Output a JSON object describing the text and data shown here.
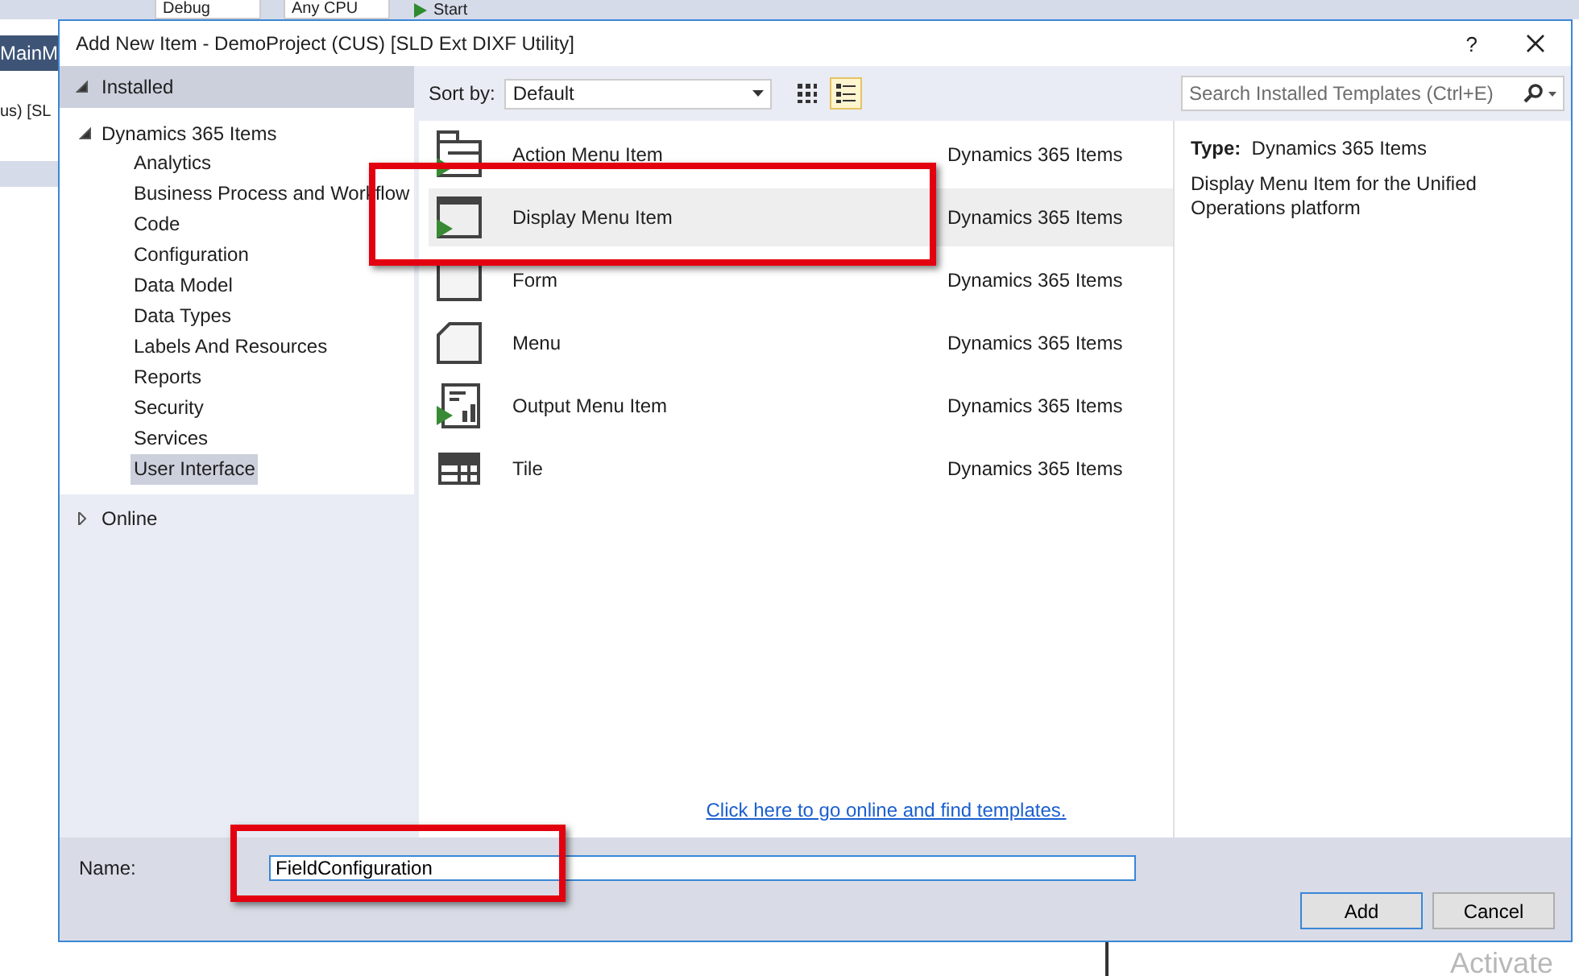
{
  "background": {
    "toolbar": [
      {
        "kind": "dropdown",
        "label": "Debug"
      },
      {
        "kind": "dropdown",
        "label": "Any CPU"
      },
      {
        "kind": "start",
        "label": "Start"
      }
    ],
    "tab": "MainM",
    "path_fragment": "us) [SL",
    "watermark": "Activate"
  },
  "dialog": {
    "title": "Add New Item - DemoProject (CUS) [SLD Ext DIXF Utility]",
    "help": "?"
  },
  "tree": [
    {
      "label": "Installed",
      "expanded": true,
      "children": [
        {
          "label": "Dynamics 365 Items",
          "expanded": true,
          "children": [
            {
              "label": "Analytics",
              "selected": false
            },
            {
              "label": "Business Process and Workflow",
              "selected": false
            },
            {
              "label": "Code",
              "selected": false
            },
            {
              "label": "Configuration",
              "selected": false
            },
            {
              "label": "Data Model",
              "selected": false
            },
            {
              "label": "Data Types",
              "selected": false
            },
            {
              "label": "Labels And Resources",
              "selected": false
            },
            {
              "label": "Reports",
              "selected": false
            },
            {
              "label": "Security",
              "selected": false
            },
            {
              "label": "Services",
              "selected": false
            },
            {
              "label": "User Interface",
              "selected": true
            }
          ]
        }
      ]
    },
    {
      "label": "Online",
      "expanded": false
    }
  ],
  "sort": {
    "label": "Sort by:",
    "value": "Default"
  },
  "view_buttons": [
    {
      "kind": "grid",
      "selected": false
    },
    {
      "kind": "list",
      "selected": true
    }
  ],
  "search": {
    "placeholder": "Search Installed Templates (Ctrl+E)"
  },
  "templates": [
    {
      "kind": "action",
      "name": "Action Menu Item",
      "category": "Dynamics 365 Items",
      "selected": false
    },
    {
      "kind": "display",
      "name": "Display Menu Item",
      "category": "Dynamics 365 Items",
      "selected": true
    },
    {
      "kind": "form",
      "name": "Form",
      "category": "Dynamics 365 Items",
      "selected": false
    },
    {
      "kind": "menu",
      "name": "Menu",
      "category": "Dynamics 365 Items",
      "selected": false
    },
    {
      "kind": "output",
      "name": "Output Menu Item",
      "category": "Dynamics 365 Items",
      "selected": false
    },
    {
      "kind": "tile",
      "name": "Tile",
      "category": "Dynamics 365 Items",
      "selected": false
    }
  ],
  "details": {
    "type_label": "Type:",
    "type_value": "Dynamics 365 Items",
    "description": "Display Menu Item for the Unified Operations platform"
  },
  "online_link": "Click here to go online and find templates.",
  "name_field": {
    "label": "Name:",
    "value": "FieldConfiguration"
  },
  "buttons": [
    {
      "label": "Add",
      "default": true
    },
    {
      "label": "Cancel",
      "default": false
    }
  ]
}
